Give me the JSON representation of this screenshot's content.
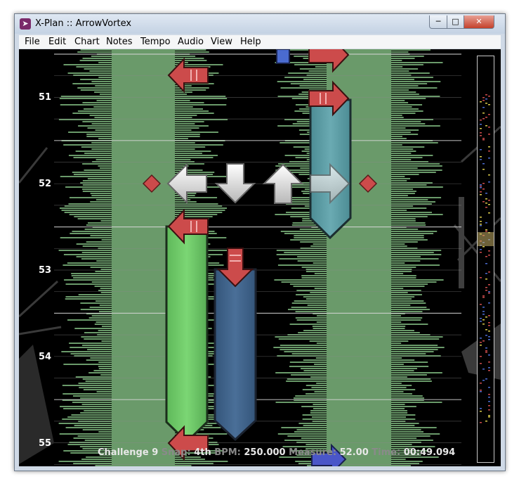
{
  "window": {
    "title": "X-Plan :: ArrowVortex",
    "app_icon": "arrowvortex-logo-icon",
    "buttons": {
      "minimize": "minimize-icon",
      "maximize": "maximize-icon",
      "close": "close-icon"
    }
  },
  "menu": [
    "File",
    "Edit",
    "Chart",
    "Notes",
    "Tempo",
    "Audio",
    "View",
    "Help"
  ],
  "editor": {
    "measure_numbers": [
      "51",
      "52",
      "53",
      "54",
      "55"
    ],
    "receptors": [
      "left",
      "down",
      "up",
      "right"
    ],
    "colors": {
      "waveform": "#6a9a6a",
      "note_red": "#cc4b4b",
      "note_blue": "#4a6bd0",
      "hold_green": "#6ec766",
      "hold_blue": "#3d5f86",
      "hold_teal": "#5a9aa2",
      "receptor": "#e0e0e0"
    }
  },
  "status": {
    "difficulty": "Challenge",
    "level": "9",
    "snap_label": "Snap:",
    "snap": "4th",
    "bpm_label": "BPM:",
    "bpm": "250.000",
    "measure_label": "Measure:",
    "measure": "52.00",
    "time_label": "Time:",
    "time": "00:49.094"
  }
}
